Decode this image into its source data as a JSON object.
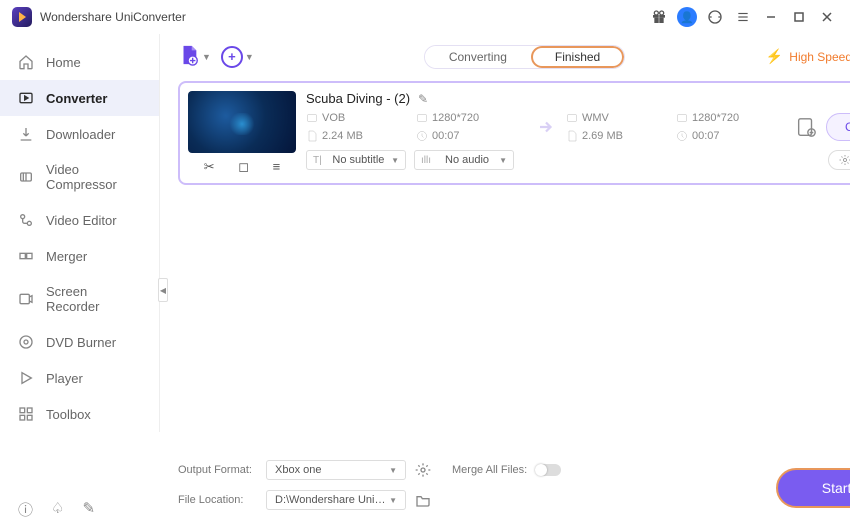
{
  "app": {
    "title": "Wondershare UniConverter"
  },
  "sidebar": {
    "items": [
      {
        "label": "Home",
        "icon": "home-icon"
      },
      {
        "label": "Converter",
        "icon": "converter-icon",
        "active": true
      },
      {
        "label": "Downloader",
        "icon": "downloader-icon"
      },
      {
        "label": "Video Compressor",
        "icon": "compressor-icon"
      },
      {
        "label": "Video Editor",
        "icon": "editor-icon"
      },
      {
        "label": "Merger",
        "icon": "merger-icon"
      },
      {
        "label": "Screen Recorder",
        "icon": "recorder-icon"
      },
      {
        "label": "DVD Burner",
        "icon": "burner-icon"
      },
      {
        "label": "Player",
        "icon": "player-icon"
      },
      {
        "label": "Toolbox",
        "icon": "toolbox-icon"
      }
    ]
  },
  "tabs": {
    "converting_label": "Converting",
    "finished_label": "Finished",
    "active": "Finished"
  },
  "topbar": {
    "high_speed_label": "High Speed Conversion"
  },
  "file": {
    "title": "Scuba Diving - (2)",
    "source": {
      "format": "VOB",
      "resolution": "1280*720",
      "size": "2.24 MB",
      "duration": "00:07"
    },
    "target": {
      "format": "WMV",
      "resolution": "1280*720",
      "size": "2.69 MB",
      "duration": "00:07"
    },
    "subtitle_value": "No subtitle",
    "audio_value": "No audio",
    "settings_label": "Settings",
    "convert_label": "Convert"
  },
  "bottom": {
    "output_format_label": "Output Format:",
    "output_format_value": "Xbox one",
    "file_location_label": "File Location:",
    "file_location_value": "D:\\Wondershare UniConverter",
    "merge_label": "Merge All Files:",
    "merge_on": false,
    "start_all_label": "Start All"
  }
}
